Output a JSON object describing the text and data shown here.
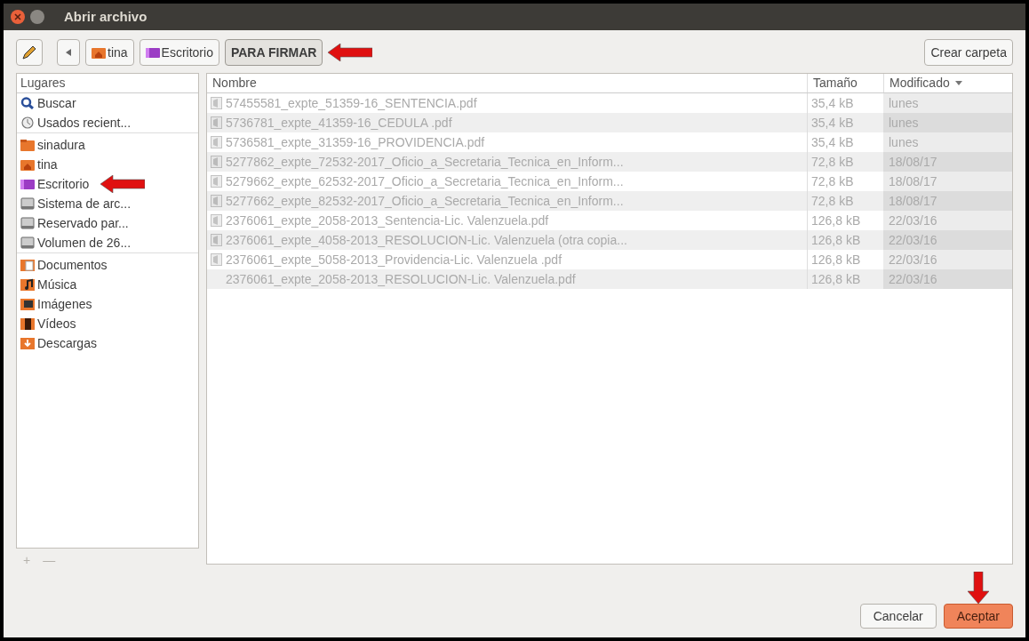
{
  "window": {
    "title": "Abrir archivo"
  },
  "path": [
    {
      "label": "tina",
      "kind": "home",
      "selected": false,
      "annotated": false
    },
    {
      "label": "Escritorio",
      "kind": "desktop",
      "selected": false,
      "annotated": false
    },
    {
      "label": "PARA FIRMAR",
      "kind": "plain",
      "selected": true,
      "annotated": true
    }
  ],
  "create_folder": "Crear carpeta",
  "places": {
    "title": "Lugares",
    "sections": [
      [
        {
          "label": "Buscar",
          "kind": "search",
          "annotated": false
        },
        {
          "label": "Usados recient...",
          "kind": "recent",
          "annotated": false
        }
      ],
      [
        {
          "label": "sinadura",
          "kind": "folder",
          "annotated": false
        },
        {
          "label": "tina",
          "kind": "home",
          "annotated": false
        },
        {
          "label": "Escritorio",
          "kind": "desktop",
          "annotated": true
        },
        {
          "label": "Sistema de arc...",
          "kind": "drive",
          "annotated": false
        },
        {
          "label": "Reservado par...",
          "kind": "drive",
          "annotated": false
        },
        {
          "label": "Volumen de 26...",
          "kind": "drive",
          "annotated": false
        }
      ],
      [
        {
          "label": "Documentos",
          "kind": "documents",
          "annotated": false
        },
        {
          "label": "Música",
          "kind": "music",
          "annotated": false
        },
        {
          "label": "Imágenes",
          "kind": "pictures",
          "annotated": false
        },
        {
          "label": "Vídeos",
          "kind": "videos",
          "annotated": false
        },
        {
          "label": "Descargas",
          "kind": "downloads",
          "annotated": false
        }
      ]
    ]
  },
  "table": {
    "columns": [
      {
        "label": "Nombre",
        "sorted": false
      },
      {
        "label": "Tamaño",
        "sorted": false
      },
      {
        "label": "Modificado",
        "sorted": true
      }
    ],
    "rows": [
      {
        "kind": "pdf",
        "name": "57455581_expte_51359-16_SENTENCIA.pdf",
        "size": "35,4 kB",
        "modified": "lunes",
        "disabled": true
      },
      {
        "kind": "pdf",
        "name": "5736781_expte_41359-16_CEDULA .pdf",
        "size": "35,4 kB",
        "modified": "lunes",
        "disabled": true
      },
      {
        "kind": "pdf",
        "name": "5736581_expte_31359-16_PROVIDENCIA.pdf",
        "size": "35,4 kB",
        "modified": "lunes",
        "disabled": true
      },
      {
        "kind": "pdf",
        "name": "5277862_expte_72532-2017_Oficio_a_Secretaria_Tecnica_en_Inform...",
        "size": "72,8 kB",
        "modified": "18/08/17",
        "disabled": true
      },
      {
        "kind": "pdf",
        "name": "5279662_expte_62532-2017_Oficio_a_Secretaria_Tecnica_en_Inform...",
        "size": "72,8 kB",
        "modified": "18/08/17",
        "disabled": true
      },
      {
        "kind": "pdf",
        "name": "5277662_expte_82532-2017_Oficio_a_Secretaria_Tecnica_en_Inform...",
        "size": "72,8 kB",
        "modified": "18/08/17",
        "disabled": true
      },
      {
        "kind": "pdf",
        "name": "2376061_expte_2058-2013_Sentencia-Lic. Valenzuela.pdf",
        "size": "126,8 kB",
        "modified": "22/03/16",
        "disabled": true
      },
      {
        "kind": "pdf",
        "name": "2376061_expte_4058-2013_RESOLUCION-Lic. Valenzuela (otra copia...",
        "size": "126,8 kB",
        "modified": "22/03/16",
        "disabled": true
      },
      {
        "kind": "pdf",
        "name": "2376061_expte_5058-2013_Providencia-Lic. Valenzuela .pdf",
        "size": "126,8 kB",
        "modified": "22/03/16",
        "disabled": true
      },
      {
        "kind": "blank",
        "name": "2376061_expte_2058-2013_RESOLUCION-Lic. Valenzuela.pdf",
        "size": "126,8 kB",
        "modified": "22/03/16",
        "disabled": true
      }
    ]
  },
  "places_controls": [
    "+",
    "—"
  ],
  "buttons": [
    {
      "label": "Cancelar",
      "kind": "secondary",
      "annotated": false
    },
    {
      "label": "Aceptar",
      "kind": "primary",
      "annotated": true
    }
  ]
}
